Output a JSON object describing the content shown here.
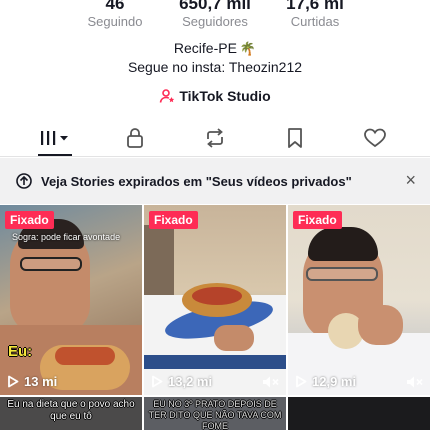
{
  "stats": [
    {
      "value": "46",
      "label": "Seguindo"
    },
    {
      "value": "650,7 mil",
      "label": "Seguidores"
    },
    {
      "value": "17,6 mi",
      "label": "Curtidas"
    }
  ],
  "bio": {
    "line1": "Recife-PE",
    "line1_emoji": "🌴",
    "line2": "Segue no insta: Theozin212"
  },
  "studio": {
    "label": "TikTok Studio",
    "icon": "person-star-icon",
    "accent": "#fe2c55"
  },
  "tabs": [
    {
      "name": "videos-grid",
      "icon": "bars-dropdown-icon",
      "active": true
    },
    {
      "name": "private",
      "icon": "lock-icon"
    },
    {
      "name": "reposts",
      "icon": "repost-icon"
    },
    {
      "name": "favorites",
      "icon": "bookmark-icon"
    },
    {
      "name": "liked",
      "icon": "heart-icon"
    }
  ],
  "banner": {
    "text": "Veja Stories expirados em \"Seus vídeos privados\"",
    "close": "×"
  },
  "videos": [
    {
      "pinned": "Fixado",
      "views": "13 mi",
      "overlay": "Sogra: pode ficar avontade",
      "sticker": "Eu:",
      "muted": false
    },
    {
      "pinned": "Fixado",
      "views": "13,2 mi",
      "muted": true
    },
    {
      "pinned": "Fixado",
      "views": "12,9 mi",
      "muted": true
    }
  ],
  "next_row": [
    {
      "caption": "Eu na dieta que o povo acho que eu tô"
    },
    {
      "caption": "EU NO 3º PRATO DEPOIS DE TER DITO QUE NÃO TAVA COM FOME"
    },
    {
      "caption": ""
    }
  ],
  "colors": {
    "pinned_badge": "#fe2c55",
    "text": "#161823",
    "muted_text": "#8a8b91",
    "banner_bg": "#f1f1f2"
  }
}
